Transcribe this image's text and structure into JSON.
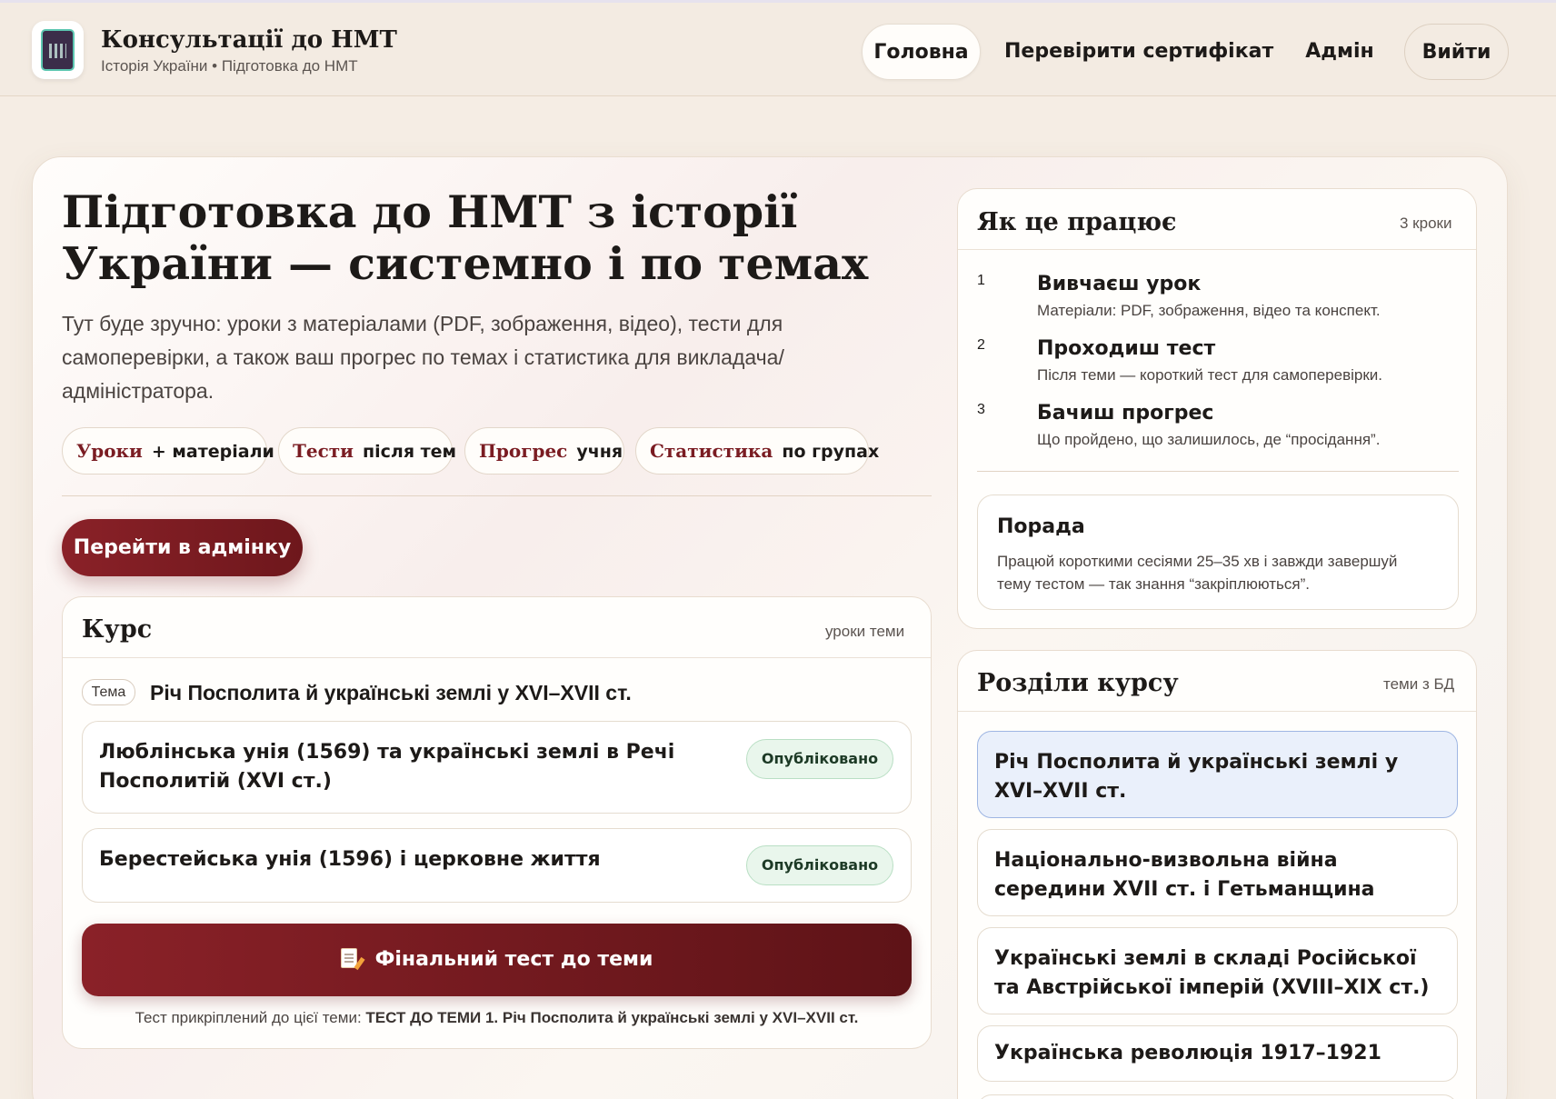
{
  "header": {
    "brand_title": "Консультації до НМТ",
    "brand_subtitle": "Історія України • Підготовка до НМТ",
    "logo_icon": "book-cover-icon",
    "nav": {
      "home": "Головна",
      "certificate": "Перевірити сертифікат",
      "admin": "Адмін",
      "logout": "Вийти"
    }
  },
  "hero": {
    "title": "Підготовка до НМТ з історії України — системно і по темах",
    "text": "Тут буде зручно: уроки з матеріалами (PDF, зображення, відео), тести для самоперевірки, а також ваш прогрес по темах і статистика для викладача/адміністратора.",
    "pills": [
      {
        "key": "Уроки",
        "value": "+ матеріали"
      },
      {
        "key": "Тести",
        "value": "після тем"
      },
      {
        "key": "Прогрес",
        "value": "учня"
      },
      {
        "key": "Статистика",
        "value": "по групах"
      }
    ],
    "admin_button": "Перейти в адмінку"
  },
  "course": {
    "title": "Курс",
    "note": "уроки теми",
    "topic_tag": "Тема",
    "topic_name": "Річ Посполита й українські землі у XVI–XVII ст.",
    "lessons": [
      {
        "title": "Люблінська унія (1569) та українські землі в Речі Посполитій (XVI ст.)",
        "status": "Опубліковано"
      },
      {
        "title": "Берестейська унія (1596) і церковне життя",
        "status": "Опубліковано"
      }
    ],
    "final_test_button": "Фінальний тест до теми",
    "final_test_icon": "document-pencil-icon",
    "final_note_prefix": "Тест прикріплений до цієї теми: ",
    "final_note_test": "ТЕСТ ДО ТЕМИ 1. Річ Посполита й українські землі у XVI–XVII ст."
  },
  "how": {
    "title": "Як це працює",
    "note": "3 кроки",
    "steps": [
      {
        "num": "1",
        "title": "Вивчаєш урок",
        "desc": "Матеріали: PDF, зображення, відео та конспект."
      },
      {
        "num": "2",
        "title": "Проходиш тест",
        "desc": "Після теми — короткий тест для самоперевірки."
      },
      {
        "num": "3",
        "title": "Бачиш прогрес",
        "desc": "Що пройдено, що залишилось, де “просідання”."
      }
    ],
    "tip_title": "Порада",
    "tip_text": "Працюй короткими сесіями 25–35 хв і завжди завершуй тему тестом — так знання “закріплюються”."
  },
  "sections": {
    "title": "Розділи курсу",
    "note": "теми з БД",
    "items": [
      "Річ Посполита й українські землі у XVI–XVII ст.",
      "Національно-визвольна війна середини XVII ст. і Гетьманщина",
      "Українські землі в складі Російської та Австрійської імперій (XVIII–XIX ст.)",
      "Українська революція 1917–1921",
      ""
    ]
  },
  "colors": {
    "accent": "#7a1c22",
    "background": "#f5ede4",
    "published_badge": "#e9f6ec",
    "active_section": "#eaf0fb"
  }
}
